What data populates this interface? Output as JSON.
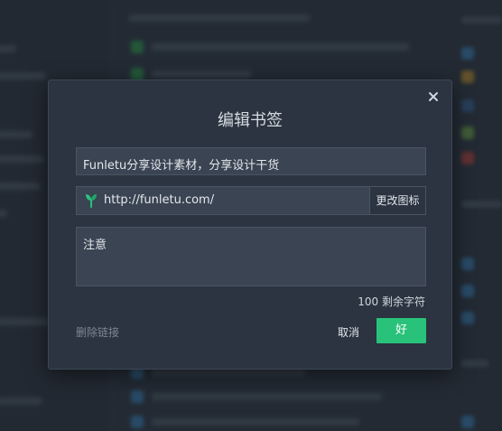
{
  "dialog": {
    "title": "编辑书签",
    "close_icon": "close-icon",
    "title_value": "Funletu分享设计素材，分享设计干货",
    "url_value": "http://funletu.com/",
    "site_icon": "leaf-icon",
    "site_icon_color": "#29c27a",
    "change_icon_label": "更改图标",
    "note_value": "注意",
    "remaining_chars": "100 剩余字符",
    "delete_link_label": "删除链接",
    "cancel_label": "取消",
    "ok_label": "好",
    "accent_color": "#29c27a"
  }
}
